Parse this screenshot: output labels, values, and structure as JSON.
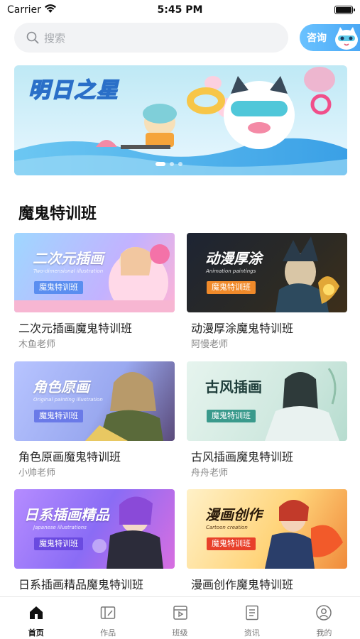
{
  "status_bar": {
    "carrier": "Carrier",
    "time": "5:45 PM"
  },
  "search": {
    "placeholder": "搜索"
  },
  "consult": {
    "label": "咨询"
  },
  "banner": {
    "title": "明日之星"
  },
  "section": {
    "title": "魔鬼特训班"
  },
  "courses": [
    {
      "thumb_title": "二次元插画",
      "thumb_sub": "Two-dimensional illustration",
      "badge": "魔鬼特训班",
      "title": "二次元插画魔鬼特训班",
      "teacher": "木鱼老师"
    },
    {
      "thumb_title": "动漫厚涂",
      "thumb_sub": "Animation paintings",
      "badge": "魔鬼特训班",
      "title": "动漫厚涂魔鬼特训班",
      "teacher": "阿慢老师"
    },
    {
      "thumb_title": "角色原画",
      "thumb_sub": "Original painting illustration",
      "badge": "魔鬼特训班",
      "title": "角色原画魔鬼特训班",
      "teacher": "小帅老师"
    },
    {
      "thumb_title": "古风插画",
      "thumb_sub": "",
      "badge": "魔鬼特训班",
      "title": "古风插画魔鬼特训班",
      "teacher": "舟舟老师"
    },
    {
      "thumb_title": "日系插画精品",
      "thumb_sub": "Japanese illustrations",
      "badge": "魔鬼特训班",
      "title": "日系插画精品魔鬼特训班",
      "teacher": ""
    },
    {
      "thumb_title": "漫画创作",
      "thumb_sub": "Cartoon creation",
      "badge": "魔鬼特训班",
      "title": "漫画创作魔鬼特训班",
      "teacher": ""
    }
  ],
  "tabs": [
    {
      "label": "首页",
      "icon": "home-icon",
      "active": true
    },
    {
      "label": "作品",
      "icon": "works-icon",
      "active": false
    },
    {
      "label": "班级",
      "icon": "class-icon",
      "active": false
    },
    {
      "label": "资讯",
      "icon": "news-icon",
      "active": false
    },
    {
      "label": "我的",
      "icon": "profile-icon",
      "active": false
    }
  ],
  "colors": {
    "accent": "#4aa8f5",
    "active_tab": "#111111",
    "inactive_tab": "#777777"
  }
}
